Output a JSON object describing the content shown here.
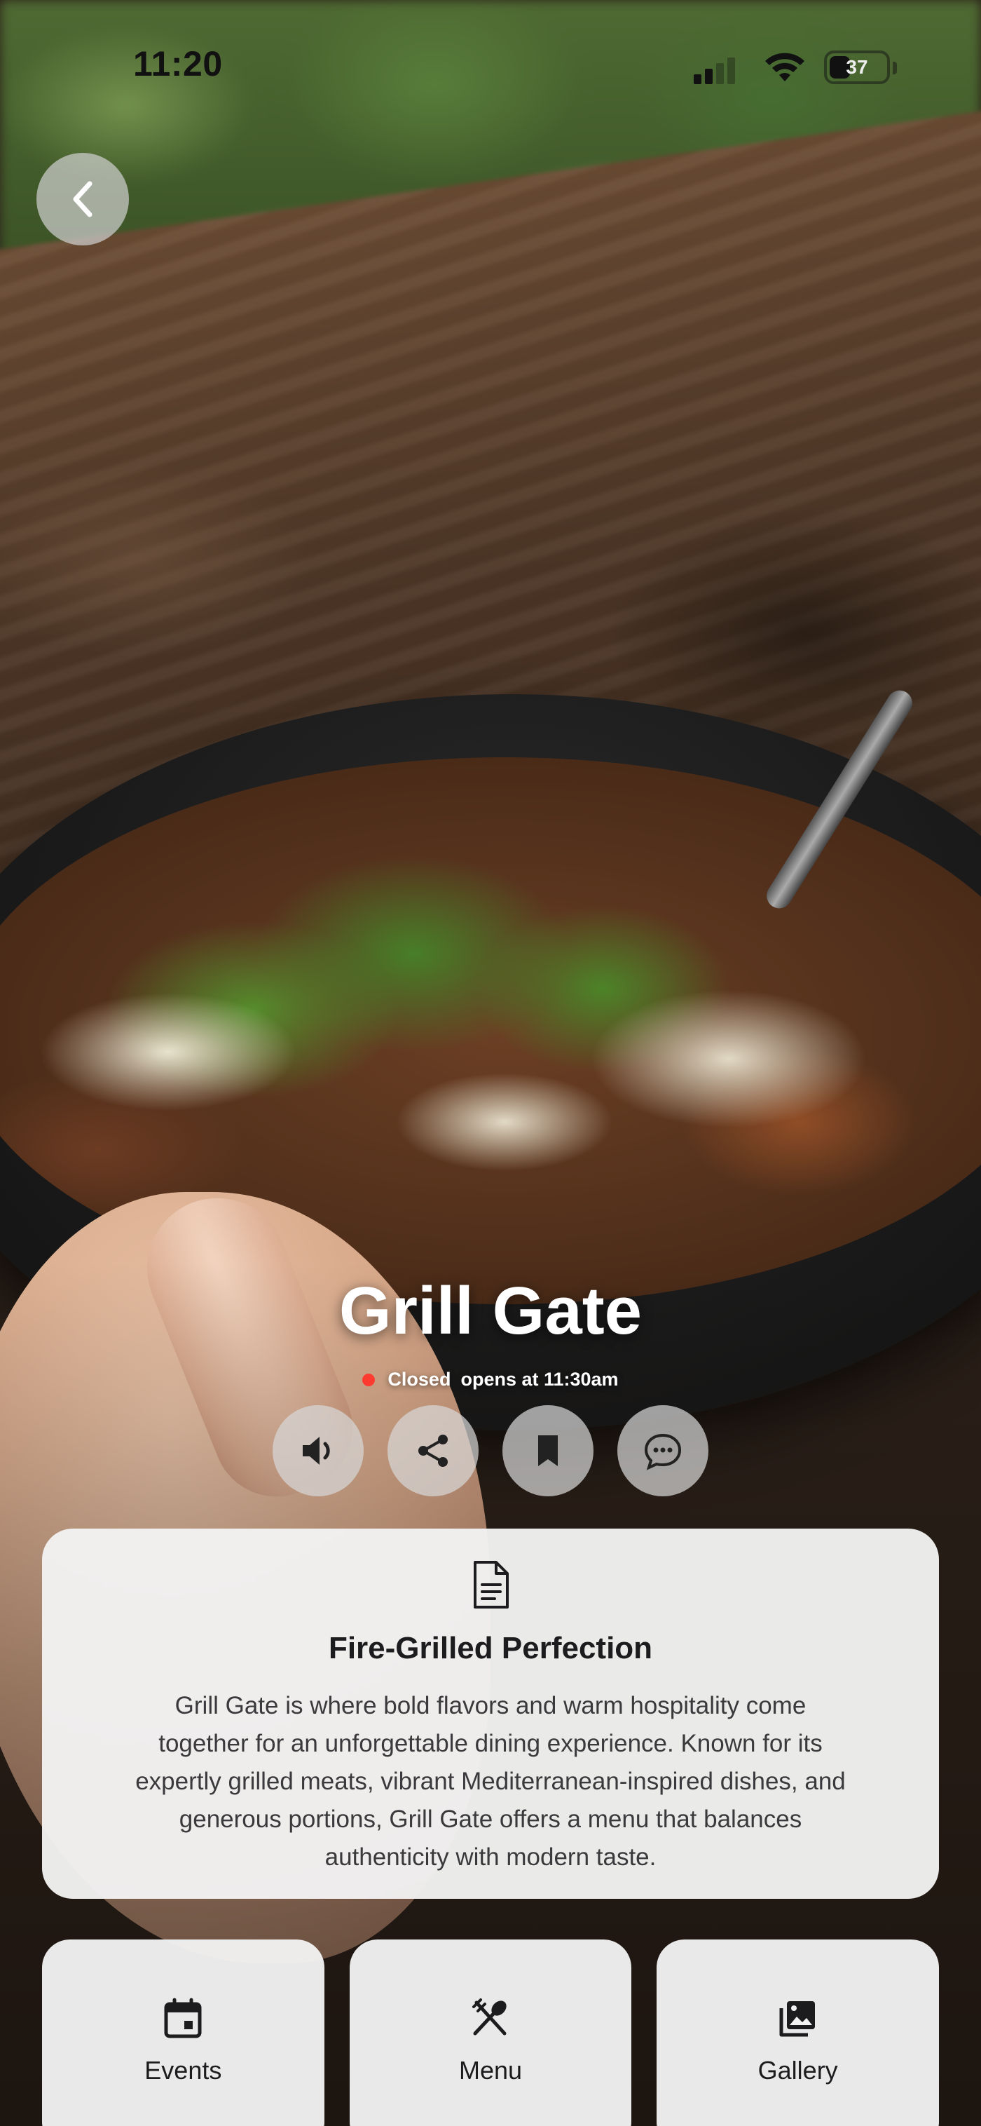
{
  "status_bar": {
    "time": "11:20",
    "battery": "37",
    "battery_fraction": 0.37
  },
  "venue": {
    "name": "Grill Gate",
    "status": "Closed",
    "status_color": "#ff3b30",
    "opens": "opens at 11:30am"
  },
  "actions": [
    {
      "icon": "speaker-icon"
    },
    {
      "icon": "share-icon"
    },
    {
      "icon": "bookmark-icon"
    },
    {
      "icon": "chat-icon"
    }
  ],
  "info_card": {
    "icon": "document-icon",
    "title": "Fire-Grilled Perfection",
    "lines": [
      "Grill Gate is where bold flavors and warm hospitality come",
      "together for an unforgettable dining experience. Known for its",
      "expertly grilled meats, vibrant Mediterranean-inspired dishes, and",
      "generous portions, Grill Gate offers a menu that balances",
      "authenticity with modern taste."
    ]
  },
  "tiles": [
    {
      "label": "Events",
      "icon": "calendar-icon"
    },
    {
      "label": "Menu",
      "icon": "fork-spoon-icon"
    },
    {
      "label": "Gallery",
      "icon": "gallery-icon"
    }
  ]
}
